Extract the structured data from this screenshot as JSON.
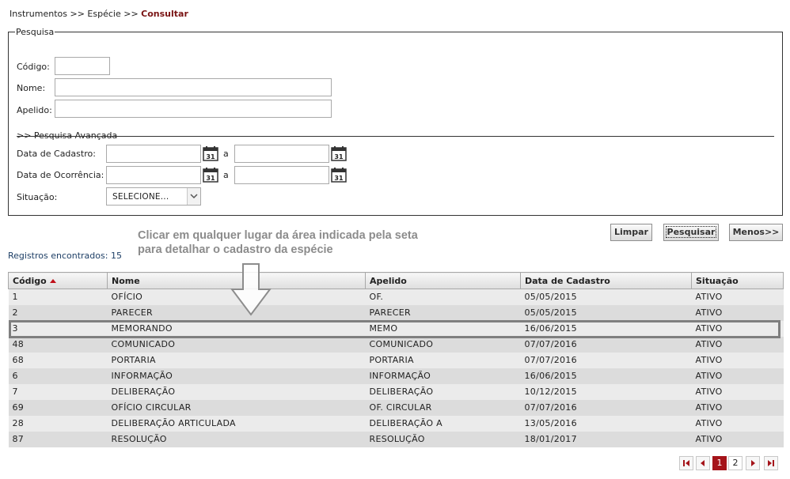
{
  "breadcrumb": {
    "part1": "Instrumentos",
    "sep": ">>",
    "part2": "Espécie",
    "current": "Consultar"
  },
  "search": {
    "legend": "Pesquisa",
    "codigo_label": "Código:",
    "codigo_value": "",
    "nome_label": "Nome:",
    "nome_value": "",
    "apelido_label": "Apelido:",
    "apelido_value": "",
    "advanced_link": ">> Pesquisa Avançada",
    "data_cadastro_label": "Data de Cadastro:",
    "data_ocorrencia_label": "Data de Ocorrência:",
    "range_sep": "a",
    "calendar_day": "31",
    "situacao_label": "Situação:",
    "situacao_value": "SELECIONE..."
  },
  "buttons": {
    "limpar": "Limpar",
    "pesquisar": "Pesquisar",
    "menos": "Menos>>"
  },
  "hint": {
    "line1": "Clicar em qualquer lugar da área indicada pela seta",
    "line2": "para detalhar o cadastro da espécie"
  },
  "results": {
    "count_label": "Registros encontrados: 15",
    "columns": [
      "Código",
      "Nome",
      "Apelido",
      "Data de Cadastro",
      "Situação"
    ],
    "rows": [
      [
        "1",
        "OFÍCIO",
        "OF.",
        "05/05/2015",
        "ATIVO"
      ],
      [
        "2",
        "PARECER",
        "PARECER",
        "05/05/2015",
        "ATIVO"
      ],
      [
        "3",
        "MEMORANDO",
        "MEMO",
        "16/06/2015",
        "ATIVO"
      ],
      [
        "48",
        "COMUNICADO",
        "COMUNICADO",
        "07/07/2016",
        "ATIVO"
      ],
      [
        "68",
        "PORTARIA",
        "PORTARIA",
        "07/07/2016",
        "ATIVO"
      ],
      [
        "6",
        "INFORMAÇÃO",
        "INFORMAÇÃO",
        "16/06/2015",
        "ATIVO"
      ],
      [
        "7",
        "DELIBERAÇÃO",
        "DELIBERAÇÃO",
        "10/12/2015",
        "ATIVO"
      ],
      [
        "69",
        "OFÍCIO CIRCULAR",
        "OF. CIRCULAR",
        "07/07/2016",
        "ATIVO"
      ],
      [
        "28",
        "DELIBERAÇÃO ARTICULADA",
        "DELIBERAÇÃO A",
        "13/05/2016",
        "ATIVO"
      ],
      [
        "87",
        "RESOLUÇÃO",
        "RESOLUÇÃO",
        "18/01/2017",
        "ATIVO"
      ]
    ]
  },
  "pagination": {
    "current": "1",
    "next": "2"
  },
  "colors": {
    "accent": "#a5141a",
    "breadcrumb_current": "#7a1414",
    "count_text": "#1e3f66"
  }
}
